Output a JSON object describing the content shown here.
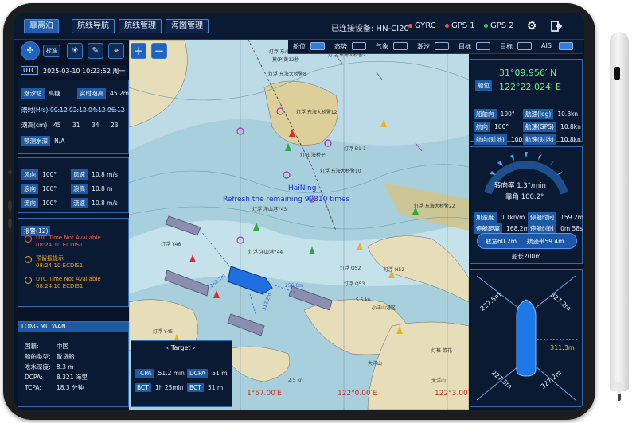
{
  "topbar": {
    "buttons": [
      "靠离泊",
      "航线导航",
      "航线管理",
      "海图管理"
    ],
    "device_label": "已连接设备: HN-CI20",
    "status": [
      {
        "label": "GYRC",
        "color": "#ff4d4d"
      },
      {
        "label": "GPS 1",
        "color": "#ff4d4d"
      },
      {
        "label": "GPS 2",
        "color": "#2ecc71"
      }
    ],
    "icons": [
      "gear-icon",
      "logout-icon"
    ]
  },
  "toolbar": {
    "mode_label": "标准",
    "icons": [
      "compass-icon",
      "sun-icon",
      "ruler-icon",
      "location-pin-icon",
      "zoom-in-icon",
      "zoom-out-icon"
    ]
  },
  "layers": [
    {
      "label": "船位",
      "on": true
    },
    {
      "label": "态势",
      "on": false
    },
    {
      "label": "气象",
      "on": false
    },
    {
      "label": "潮汐",
      "on": false
    },
    {
      "label": "目标",
      "on": false
    },
    {
      "label": "目标",
      "on": false
    },
    {
      "label": "AIS",
      "on": true
    }
  ],
  "time": {
    "zone": "UTC",
    "value": "2025-03-10 10:23:52 周一"
  },
  "tide": {
    "station_label": "潮汐站",
    "station_value": "高糖",
    "realtime_label": "实时潮高",
    "realtime_value": "45.2m",
    "time_label": "潮时(Hrs)",
    "times": [
      "00:12",
      "02:12",
      "04:12",
      "06:12"
    ],
    "height_label": "潮高(cm)",
    "heights": [
      "45",
      "31",
      "34",
      "23"
    ],
    "forecast_label": "预测水深",
    "forecast_value": "N/A"
  },
  "weather": [
    {
      "l1": "风向",
      "v1": "100°",
      "l2": "风速",
      "v2": "10.8 m/s"
    },
    {
      "l1": "浪向",
      "v1": "100°",
      "l2": "浪高",
      "v2": "10.8 m"
    },
    {
      "l1": "流向",
      "v1": "100°",
      "l2": "流速",
      "v2": "10.8 m/s"
    }
  ],
  "alarms": {
    "title": "报警(12)",
    "items": [
      {
        "title": "UTC Time Not Available",
        "sub": "08:24:10  ECDIS1",
        "color": "#ff5a4a"
      },
      {
        "title": "预留报提示",
        "sub": "08:24:10  ECDIS1",
        "color": "#f0a020"
      },
      {
        "title": "UTC Time Not Available",
        "sub": "08:24:10  ECDIS1",
        "color": "#f0a020"
      }
    ]
  },
  "vessel_info": {
    "name": "LONG MU WAN",
    "rows": [
      {
        "label": "国籍:",
        "value": "中国"
      },
      {
        "label": "船舶类型:",
        "value": "散货船"
      },
      {
        "label": "吃水深度:",
        "value": "8.3 m"
      },
      {
        "label": "DCPA:",
        "value": "8.321 海里"
      },
      {
        "label": "TCPA:",
        "value": "18.3 分钟"
      }
    ]
  },
  "target": {
    "title": "Target",
    "rows": [
      {
        "l1": "TCPA",
        "v1": "51.2 min",
        "l2": "DCPA",
        "v2": "51 m"
      },
      {
        "l1": "BCT",
        "v1": "1h 25min",
        "l2": "BCT",
        "v2": "51 m"
      }
    ]
  },
  "position": {
    "label": "船位",
    "lat": "31°09.956′ N",
    "lon": "122°22.024′ E",
    "rows": [
      {
        "l1": "船舶向",
        "v1": "100°",
        "l2": "航速(log)",
        "v2": "10.8kn"
      },
      {
        "l1": "航向",
        "v1": "100°",
        "l2": "航速(GPS)",
        "v2": "10.8kn"
      },
      {
        "l1": "航向(对地)",
        "v1": "100°",
        "l2": "航速(对地)",
        "v2": "10.8kn"
      }
    ]
  },
  "turn": {
    "rate": "转向率 1.3°/min",
    "rudder": "靠角 100.2°",
    "stats": [
      {
        "l1": "加速度",
        "v1": "0.1kn/m",
        "l2": "停船时间",
        "v2": "159.2m"
      },
      {
        "l1": "停船距离",
        "v1": "168.2m",
        "l2": "停船时时",
        "v2": "0m 58s"
      }
    ],
    "left_pill": "舷宽60.2m",
    "right_pill": "航迹带59.4m",
    "length": "船长200m"
  },
  "berth": {
    "tl": "227.5m",
    "tr": "327.2m",
    "r": "311.3m",
    "bl": "227.5m",
    "br": "327.2m"
  },
  "map": {
    "ship_label": "HaiNing",
    "refresh_text": "Refresh the remaining 99310 times",
    "lon_labels": [
      "1°57.00′E",
      "122°0.00′E",
      "122°3.00′E"
    ],
    "dist_labels": [
      "262.2m",
      "312.2m",
      "256.6m"
    ],
    "chart_labels": [
      "灯浮 东海大桥警1",
      "灯浮 东海大桥警2",
      "莫(P)黄12秒",
      "灯浮 东海大桥警8",
      "灯浮 东海大桥警12",
      "灯桩 海桥平",
      "灯浮 B1-1",
      "灯浮 东海大桥警10",
      "HaiNing",
      "灯浮 洋山港Y43",
      "灯浮 东海大桥警22",
      "灯浮 Y46",
      "灯浮 洋山港Y44",
      "灯浮 Q52",
      "灯浮 H52",
      "灯浮 Q53",
      "灯浮 Y45",
      "小洋山港区",
      "大洋山",
      "大洋山",
      "灯桩 菜花",
      "5.5 kn",
      "2.5 kn"
    ]
  }
}
